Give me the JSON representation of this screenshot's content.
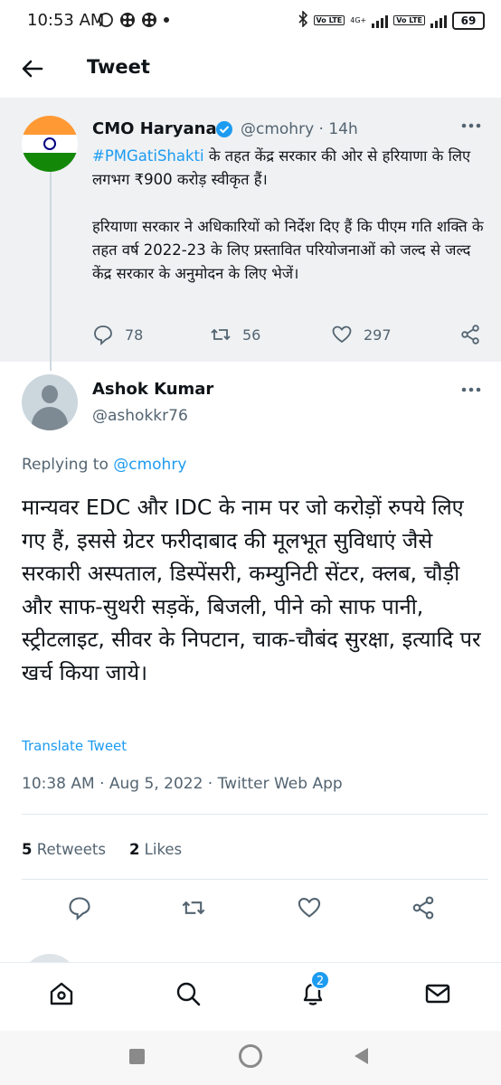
{
  "status_bar": {
    "time": "10:53 AM",
    "net_label": "4G+",
    "lte_label": "Vo LTE",
    "battery": "69"
  },
  "header": {
    "title": "Tweet"
  },
  "parent_tweet": {
    "name": "CMO Haryana",
    "handle": "@cmohry · 14h",
    "hashtag": "#PMGatiShakti",
    "text_line1": " के तहत केंद्र सरकार की ओर से हरियाणा के लिए लगभग ₹900 करोड़ स्वीकृत हैं।",
    "text_para2": "हरियाणा सरकार ने अधिकारियों को निर्देश दिए हैं कि पीएम गति शक्ति के तहत वर्ष 2022-23 के लिए प्रस्तावित परियोजनाओं को जल्द से जल्द केंद्र सरकार के अनुमोदन के लिए भेजें।",
    "replies": "78",
    "retweets": "56",
    "likes": "297"
  },
  "main_tweet": {
    "name": "Ashok Kumar",
    "handle": "@ashokkr76",
    "replying_prefix": "Replying to ",
    "replying_mention": "@cmohry",
    "text": "मान्यवर EDC और IDC के नाम पर जो करोड़ों रुपये लिए गए हैं, इससे ग्रेटर फरीदाबाद की मूलभूत सुविधाएं जैसे सरकारी अस्पताल, डिस्पेंसरी, कम्युनिटी सेंटर, क्लब, चौड़ी और साफ-सुथरी सड़कें, बिजली, पीने को साफ पानी, स्ट्रीटलाइट, सीवर के निपटान, चाक-चौबंद सुरक्षा, इत्यादि पर खर्च किया जाये।",
    "translate_label": "Translate Tweet",
    "meta": "10:38 AM · Aug 5, 2022 · Twitter Web App",
    "retweets_count": "5",
    "retweets_label": " Retweets",
    "likes_count": "2",
    "likes_label": " Likes"
  },
  "bottom_nav": {
    "notifications_badge": "2"
  },
  "colors": {
    "accent": "#1d9bf0",
    "secondary_text": "#536471",
    "quoted_bg": "#eff1f3"
  },
  "icons": [
    "back-arrow-icon",
    "verified-badge-icon",
    "more-icon",
    "reply-icon",
    "retweet-icon",
    "like-icon",
    "share-icon",
    "home-icon",
    "search-icon",
    "bell-icon",
    "mail-icon"
  ]
}
